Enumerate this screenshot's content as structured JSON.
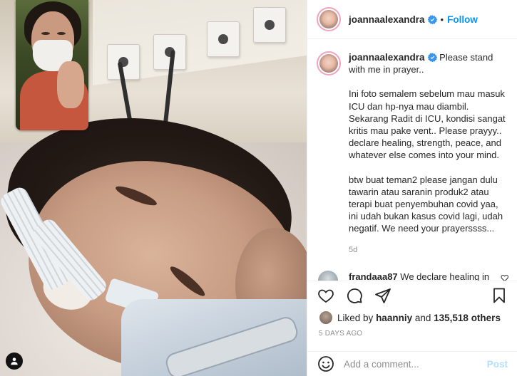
{
  "post": {
    "username": "joannaalexandra",
    "follow_label": "Follow",
    "dot": "•",
    "caption_lines": [
      "Please stand with me in prayer.."
    ],
    "caption_para2": "Ini foto semalem sebelum mau masuk ICU dan hp-nya mau diambil. Sekarang Radit di ICU, kondisi sangat kritis mau pake vent.. Please prayyy.. declare healing, strength, peace, and whatever else comes into your mind.",
    "caption_para3": "btw buat teman2 please jangan dulu tawarin atau saranin produk2 atau terapi buat penyembuhan covid yaa, ini udah bukan kasus covid lagi, udah negatif. We need your prayerssss...",
    "caption_age": "5d"
  },
  "comment": {
    "username": "frandaaa87",
    "text": "We declare healing in Jesus name!! 🙏🏻❤️"
  },
  "likes": {
    "prefix": "Liked by",
    "user": "haanniy",
    "and": "and",
    "count": "135,518 others"
  },
  "timestamp": "5 DAYS AGO",
  "add_comment": {
    "placeholder": "Add a comment...",
    "post_label": "Post"
  },
  "colors": {
    "accent": "#0095f6",
    "post_disabled": "#b2dffc",
    "muted": "#8e8e8e",
    "text": "#262626"
  },
  "icons": [
    "verified-badge-icon",
    "heart-icon",
    "comment-icon",
    "share-icon",
    "bookmark-icon",
    "emoji-icon",
    "user-tag-icon"
  ]
}
